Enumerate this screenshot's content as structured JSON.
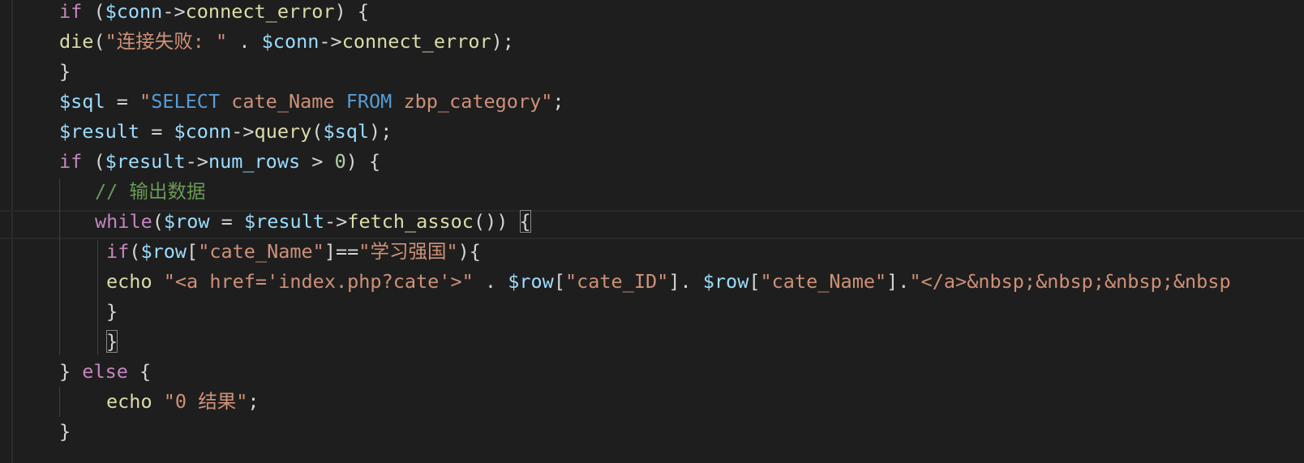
{
  "editor": {
    "lines": [
      [
        [
          "kw",
          "if"
        ],
        [
          "p",
          " ("
        ],
        [
          "var",
          "$conn"
        ],
        [
          "p",
          "->"
        ],
        [
          "fn",
          "connect_error"
        ],
        [
          "p",
          ") {"
        ]
      ],
      [
        [
          "fn",
          "die"
        ],
        [
          "p",
          "("
        ],
        [
          "str",
          "\"连接失败: \""
        ],
        [
          "p",
          " . "
        ],
        [
          "var",
          "$conn"
        ],
        [
          "p",
          "->"
        ],
        [
          "fn",
          "connect_error"
        ],
        [
          "p",
          ");"
        ]
      ],
      [
        [
          "p",
          "}"
        ]
      ],
      [
        [
          "var",
          "$sql"
        ],
        [
          "p",
          " = "
        ],
        [
          "str",
          "\""
        ],
        [
          "sqlkw",
          "SELECT"
        ],
        [
          "str",
          " cate_Name "
        ],
        [
          "sqlkw",
          "FROM"
        ],
        [
          "str",
          " zbp_category\""
        ],
        [
          "p",
          ";"
        ]
      ],
      [
        [
          "var",
          "$result"
        ],
        [
          "p",
          " = "
        ],
        [
          "var",
          "$conn"
        ],
        [
          "p",
          "->"
        ],
        [
          "fn",
          "query"
        ],
        [
          "p",
          "("
        ],
        [
          "var",
          "$sql"
        ],
        [
          "p",
          ");"
        ]
      ],
      [
        [
          "kw",
          "if"
        ],
        [
          "p",
          " ("
        ],
        [
          "var",
          "$result"
        ],
        [
          "p",
          "->"
        ],
        [
          "var",
          "num_rows"
        ],
        [
          "p",
          " > "
        ],
        [
          "num",
          "0"
        ],
        [
          "p",
          ") {"
        ]
      ],
      [
        [
          "cmt",
          "// 输出数据"
        ]
      ],
      [
        [
          "kw",
          "while"
        ],
        [
          "p",
          "("
        ],
        [
          "var",
          "$row"
        ],
        [
          "p",
          " = "
        ],
        [
          "var",
          "$result"
        ],
        [
          "p",
          "->"
        ],
        [
          "fn",
          "fetch_assoc"
        ],
        [
          "p",
          "()) "
        ],
        [
          "pm",
          "{"
        ]
      ],
      [
        [
          "kw",
          "if"
        ],
        [
          "p",
          "("
        ],
        [
          "var",
          "$row"
        ],
        [
          "p",
          "["
        ],
        [
          "str",
          "\"cate_Name\""
        ],
        [
          "p",
          "]=="
        ],
        [
          "str",
          "\"学习强国\""
        ],
        [
          "p",
          "){"
        ]
      ],
      [
        [
          "fn",
          "echo"
        ],
        [
          "p",
          " "
        ],
        [
          "str",
          "\"<a href='index.php?cate'>\""
        ],
        [
          "p",
          " . "
        ],
        [
          "var",
          "$row"
        ],
        [
          "p",
          "["
        ],
        [
          "str",
          "\"cate_ID\""
        ],
        [
          "p",
          "]. "
        ],
        [
          "var",
          "$row"
        ],
        [
          "p",
          "["
        ],
        [
          "str",
          "\"cate_Name\""
        ],
        [
          "p",
          "]."
        ],
        [
          "str",
          "\"</a>&nbsp;&nbsp;&nbsp;&nbsp"
        ]
      ],
      [
        [
          "p",
          "}"
        ]
      ],
      [
        [
          "pm",
          "}"
        ]
      ],
      [
        [
          "p",
          "} "
        ],
        [
          "kw",
          "else"
        ],
        [
          "p",
          " {"
        ]
      ],
      [
        [
          "fn",
          "echo"
        ],
        [
          "p",
          " "
        ],
        [
          "str",
          "\"0 结果\""
        ],
        [
          "p",
          ";"
        ]
      ],
      [
        [
          "p",
          "}"
        ]
      ]
    ]
  }
}
